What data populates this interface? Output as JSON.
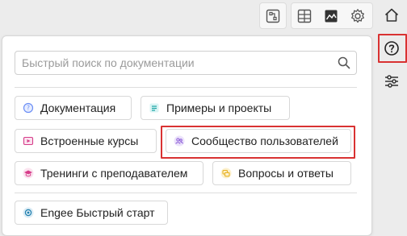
{
  "toolbar": {
    "icons": [
      "diagram-icon",
      "table-view-icon",
      "image-view-icon",
      "settings-gear-icon",
      "home-icon"
    ]
  },
  "side": {
    "icons": [
      "help-icon",
      "sliders-icon"
    ]
  },
  "help_panel": {
    "search_placeholder": "Быстрый поиск по документации",
    "links": [
      {
        "label": "Документация",
        "icon": "documentation-icon",
        "color": "#6b8ef5"
      },
      {
        "label": "Примеры и проекты",
        "icon": "examples-icon",
        "color": "#20a7a7"
      },
      {
        "label": "Встроенные курсы",
        "icon": "courses-icon",
        "color": "#d63c8a"
      },
      {
        "label": "Сообщество пользователей",
        "icon": "community-icon",
        "color": "#8a5ad6"
      },
      {
        "label": "Тренинги с преподавателем",
        "icon": "training-icon",
        "color": "#d63c8a"
      },
      {
        "label": "Вопросы и ответы",
        "icon": "qa-icon",
        "color": "#e8b221"
      }
    ],
    "quickstart": {
      "label": "Engee Быстрый старт",
      "icon": "quickstart-icon",
      "color": "#1f7fae"
    }
  },
  "colors": {
    "highlight": "#d93232",
    "panel_bg": "#ffffff",
    "page_bg": "#ececec"
  }
}
